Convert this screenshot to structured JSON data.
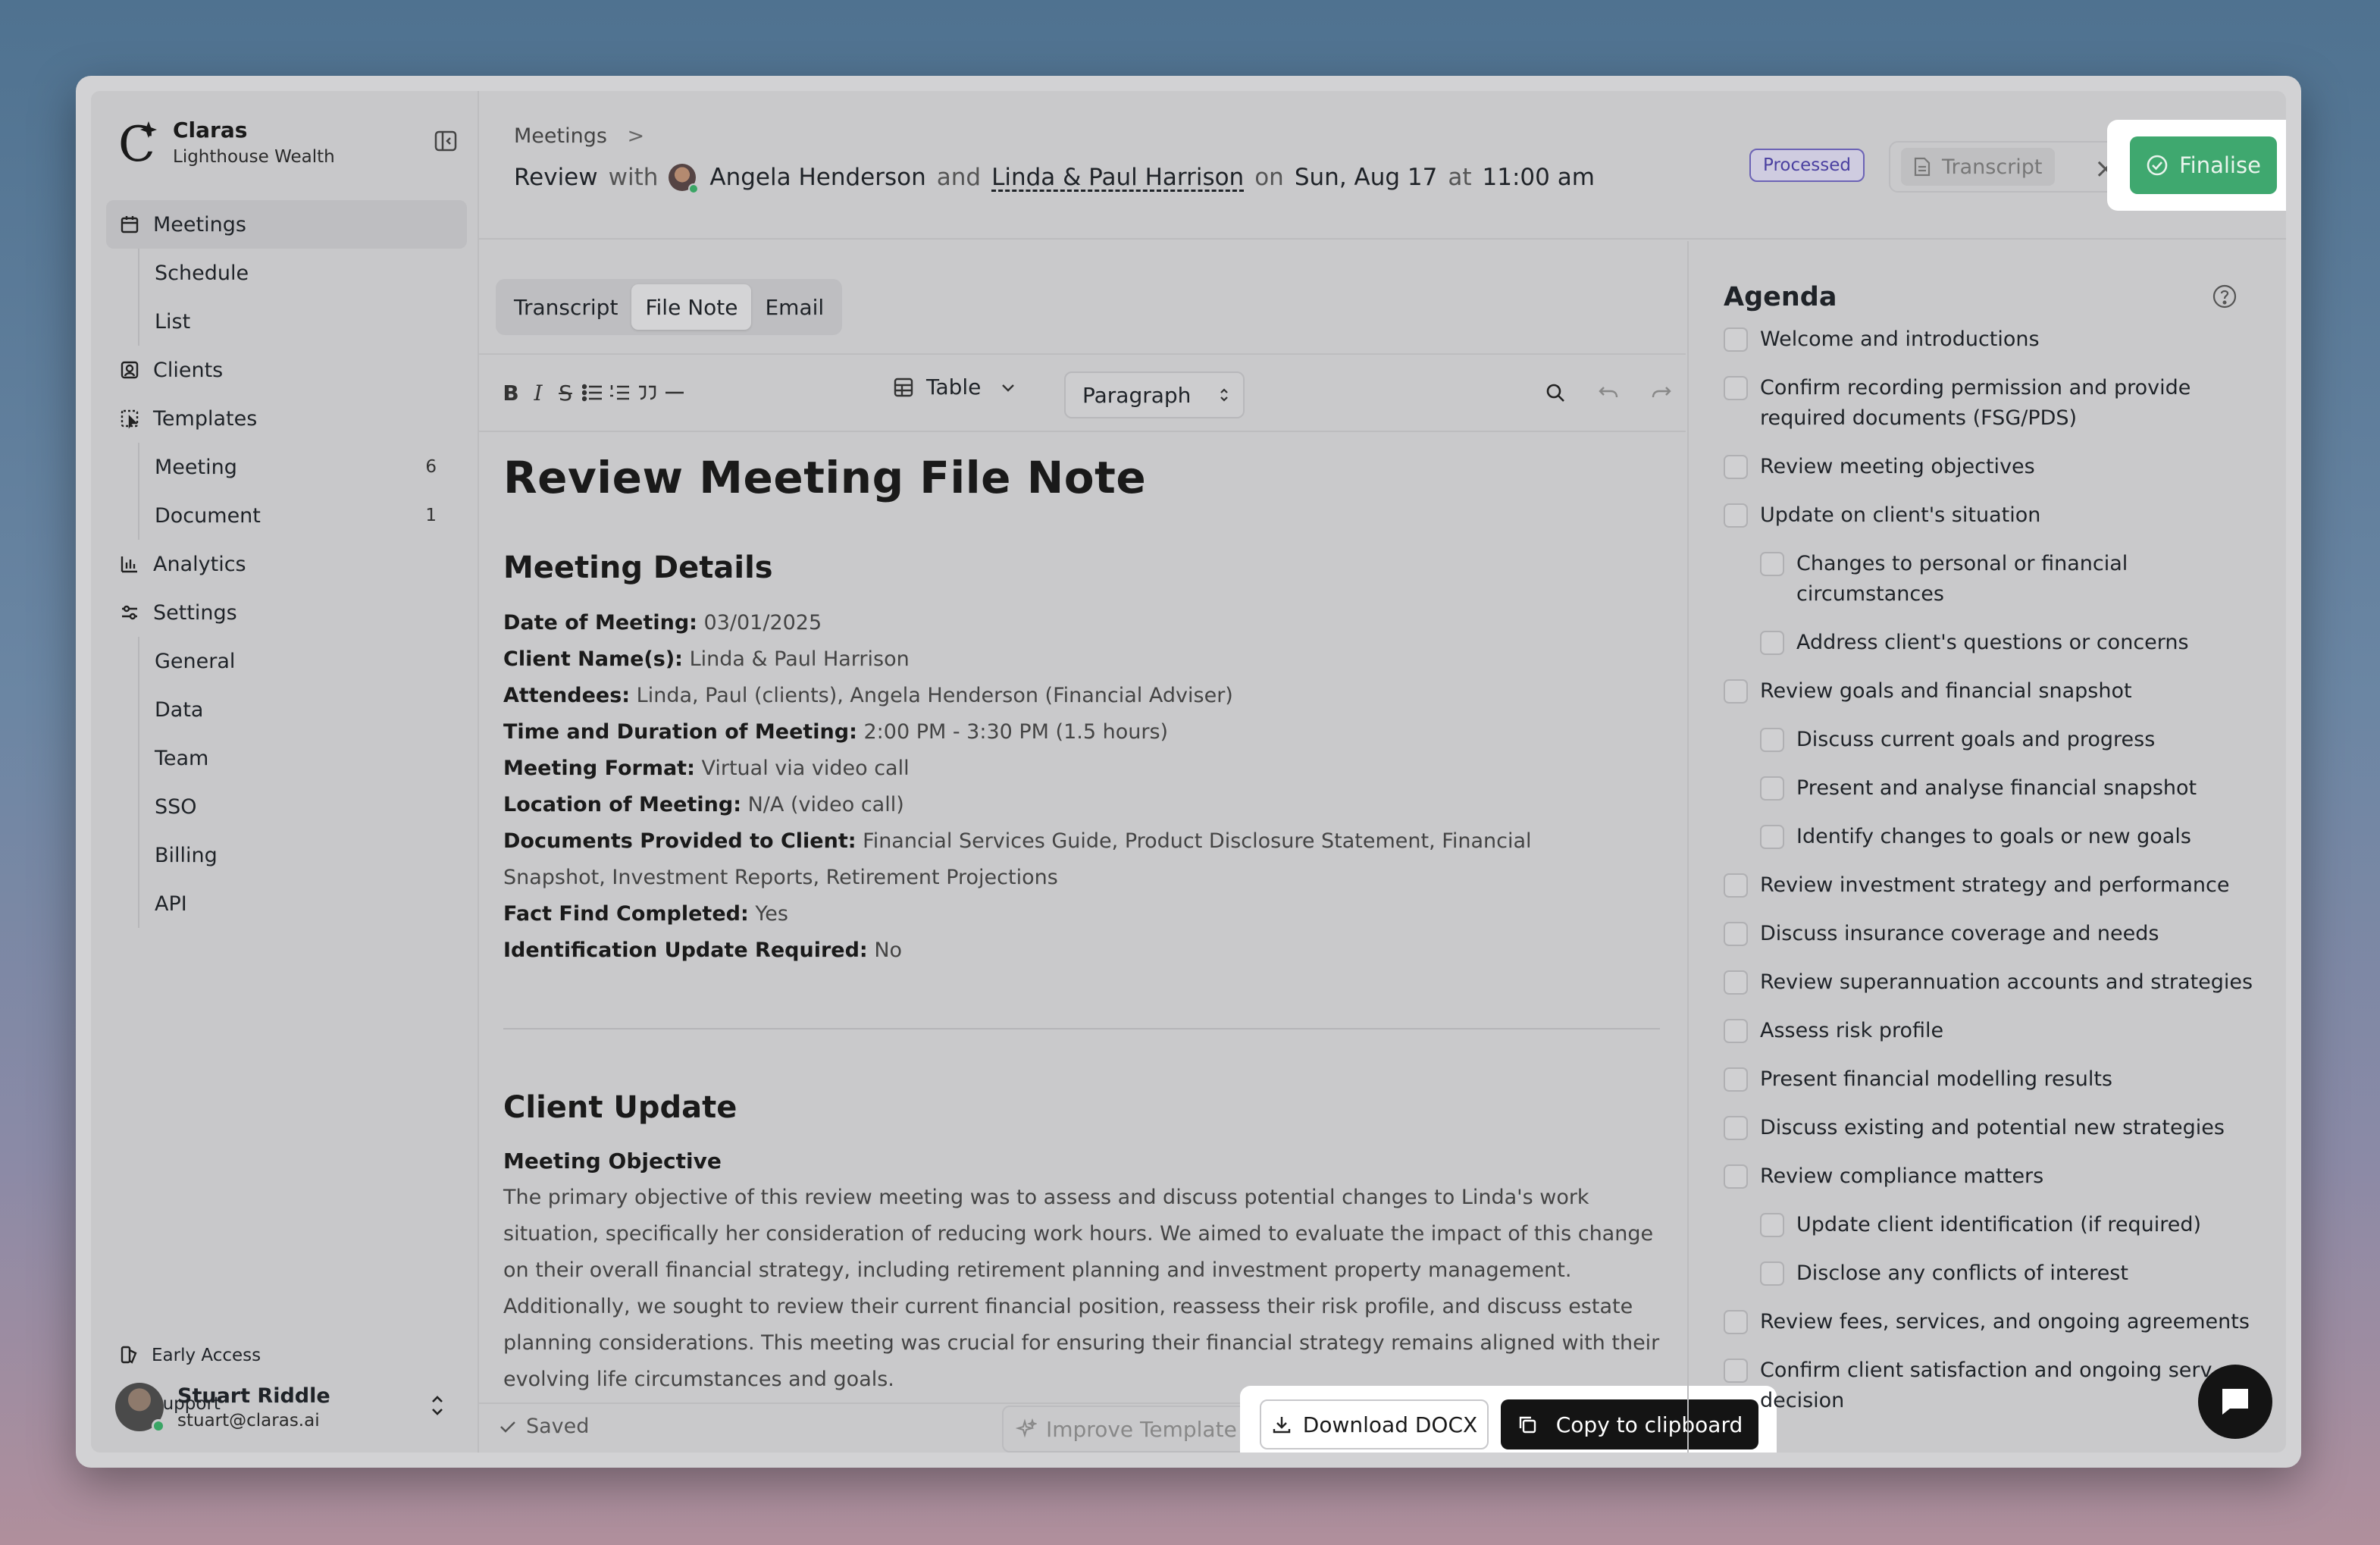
{
  "brand": {
    "name": "Claras",
    "subtitle": "Lighthouse Wealth"
  },
  "sidebar": {
    "nav": [
      {
        "label": "Meetings",
        "icon": "calendar-icon"
      },
      {
        "label": "Schedule"
      },
      {
        "label": "List"
      },
      {
        "label": "Clients",
        "icon": "contact-icon"
      },
      {
        "label": "Templates",
        "icon": "template-icon"
      },
      {
        "label": "Meeting",
        "count": "6"
      },
      {
        "label": "Document",
        "count": "1"
      },
      {
        "label": "Analytics",
        "icon": "bar-chart-icon"
      },
      {
        "label": "Settings",
        "icon": "sliders-icon"
      },
      {
        "label": "General"
      },
      {
        "label": "Data"
      },
      {
        "label": "Team"
      },
      {
        "label": "SSO"
      },
      {
        "label": "Billing"
      },
      {
        "label": "API"
      }
    ],
    "early_access": "Early Access",
    "support": "Support",
    "user": {
      "name": "Stuart Riddle",
      "email": "stuart@claras.ai"
    }
  },
  "header": {
    "crumb": "Meetings",
    "crumb_sep": ">",
    "review": "Review",
    "with": "with",
    "adviser": "Angela Henderson",
    "and": "and",
    "clients": "Linda & Paul Harrison",
    "on": "on",
    "date": "Sun, Aug 17",
    "at": "at",
    "time": "11:00 am",
    "status": "Processed",
    "transcript": "Transcript",
    "finalise": "Finalise"
  },
  "editor": {
    "tabs": [
      "Transcript",
      "File Note",
      "Email"
    ],
    "active_tab": "File Note",
    "table_label": "Table",
    "paragraph_label": "Paragraph",
    "doc_title": "Review Meeting File Note",
    "section1": "Meeting Details",
    "details": [
      {
        "label": "Date of Meeting:",
        "value": "03/01/2025"
      },
      {
        "label": "Client Name(s):",
        "value": "Linda & Paul Harrison"
      },
      {
        "label": "Attendees:",
        "value": "Linda, Paul (clients), Angela Henderson (Financial Adviser)"
      },
      {
        "label": "Time and Duration of Meeting:",
        "value": "2:00 PM - 3:30 PM (1.5 hours)"
      },
      {
        "label": "Meeting Format:",
        "value": "Virtual via video call"
      },
      {
        "label": "Location of Meeting:",
        "value": "N/A (video call)"
      },
      {
        "label": "Documents Provided to Client:",
        "value": "Financial Services Guide, Product Disclosure Statement, Financial Snapshot, Investment Reports, Retirement Projections"
      },
      {
        "label": "Fact Find Completed:",
        "value": "Yes"
      },
      {
        "label": "Identification Update Required:",
        "value": "No"
      }
    ],
    "section2": "Client Update",
    "objective_heading": "Meeting Objective",
    "objective_text": "The primary objective of this review meeting was to assess and discuss potential changes to Linda's work situation, specifically her consideration of reducing work hours. We aimed to evaluate the impact of this change on their overall financial strategy, including retirement planning and investment property management. Additionally, we sought to review their current financial position, reassess their risk profile, and discuss estate planning considerations. This meeting was crucial for ensuring their financial strategy remains aligned with their evolving life circumstances and goals.",
    "saved": "Saved",
    "improve": "Improve Template",
    "download": "Download DOCX",
    "copy": "Copy to clipboard"
  },
  "agenda": {
    "title": "Agenda",
    "items": [
      {
        "label": "Welcome and introductions",
        "level": 0
      },
      {
        "label": "Confirm recording permission and provide required documents (FSG/PDS)",
        "level": 0
      },
      {
        "label": "Review meeting objectives",
        "level": 0
      },
      {
        "label": "Update on client's situation",
        "level": 0
      },
      {
        "label": "Changes to personal or financial circumstances",
        "level": 1
      },
      {
        "label": "Address client's questions or concerns",
        "level": 1
      },
      {
        "label": "Review goals and financial snapshot",
        "level": 0
      },
      {
        "label": "Discuss current goals and progress",
        "level": 1
      },
      {
        "label": "Present and analyse financial snapshot",
        "level": 1
      },
      {
        "label": "Identify changes to goals or new goals",
        "level": 1
      },
      {
        "label": "Review investment strategy and performance",
        "level": 0
      },
      {
        "label": "Discuss insurance coverage and needs",
        "level": 0
      },
      {
        "label": "Review superannuation accounts and strategies",
        "level": 0
      },
      {
        "label": "Assess risk profile",
        "level": 0
      },
      {
        "label": "Present financial modelling results",
        "level": 0
      },
      {
        "label": "Discuss existing and potential new strategies",
        "level": 0
      },
      {
        "label": "Review compliance matters",
        "level": 0
      },
      {
        "label": "Update client identification (if required)",
        "level": 1
      },
      {
        "label": "Disclose any conflicts of interest",
        "level": 1
      },
      {
        "label": "Review fees, services, and ongoing agreements",
        "level": 0
      },
      {
        "label": "Confirm client satisfaction and ongoing serv decision",
        "level": 0
      }
    ]
  },
  "colors": {
    "finalise": "#3fa86f",
    "processed": "#4a40a0",
    "online": "#3aa565"
  }
}
